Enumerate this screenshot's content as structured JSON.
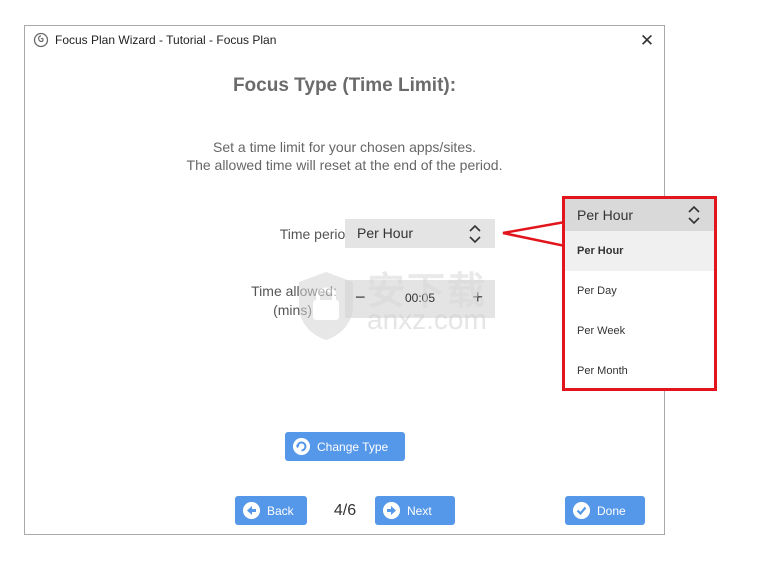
{
  "window": {
    "title": "Focus Plan Wizard - Tutorial - Focus Plan",
    "close_glyph": "✕"
  },
  "heading": "Focus Type (Time Limit):",
  "description": {
    "line1": "Set a time limit for your chosen apps/sites.",
    "line2": "The allowed time will reset at the end of the period."
  },
  "time_period": {
    "label": "Time period:",
    "value": "Per Hour"
  },
  "time_allowed": {
    "label_line1": "Time allowed:",
    "label_line2": "(mins)",
    "value": "00:05",
    "minus": "−",
    "plus": "+"
  },
  "buttons": {
    "change_type": "Change Type",
    "back": "Back",
    "next": "Next",
    "done": "Done"
  },
  "page_indicator": "4/6",
  "watermark": {
    "cn": "安下载",
    "en": "anxz.com"
  },
  "dropdown_popup": {
    "selected": "Per Hour",
    "options": [
      "Per Hour",
      "Per Day",
      "Per Week",
      "Per Month"
    ]
  },
  "colors": {
    "accent": "#5597e8",
    "highlight_border": "#e2141c"
  },
  "icons": {
    "app": "app-logo-icon",
    "select_chevron": "chevron-up-down-icon",
    "change": "refresh-icon",
    "back": "arrow-left-circle-icon",
    "next": "arrow-right-circle-icon",
    "done": "check-circle-icon"
  }
}
